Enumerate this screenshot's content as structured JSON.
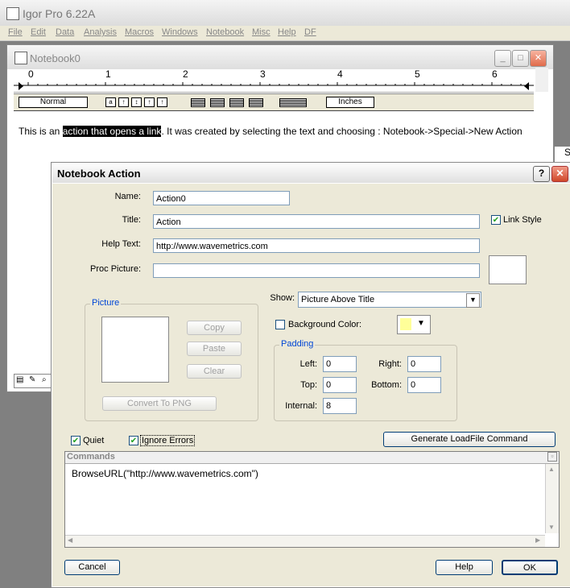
{
  "app": {
    "title": "Igor Pro 6.22A",
    "menu": [
      "File",
      "Edit",
      "Data",
      "Analysis",
      "Macros",
      "Windows",
      "Notebook",
      "Misc",
      "Help",
      "DF"
    ]
  },
  "notebook": {
    "title": "Notebook0",
    "ruler_numbers": [
      "0",
      "1",
      "2",
      "3",
      "4",
      "5",
      "6"
    ],
    "ruler_name": "Normal",
    "units": "Inches",
    "text_before": "This is an ",
    "text_highlight": "action that opens a link",
    "text_after": ". It was created by selecting the text and choosing : Notebook->Special->New Action",
    "side_peek": "S"
  },
  "dialog": {
    "title": "Notebook Action",
    "help_glyph": "?",
    "close_glyph": "✕",
    "name_label": "Name:",
    "name_value": "Action0",
    "title_label": "Title:",
    "title_value": "Action",
    "link_style_label": "Link Style",
    "help_text_label": "Help Text:",
    "help_text_value": "http://www.wavemetrics.com",
    "proc_picture_label": "Proc Picture:",
    "proc_picture_value": "",
    "picture_group": "Picture",
    "copy_label": "Copy",
    "paste_label": "Paste",
    "clear_label": "Clear",
    "convert_label": "Convert To PNG",
    "show_label": "Show:",
    "show_value": "Picture Above Title",
    "bg_color_label": "Background Color:",
    "padding_group": "Padding",
    "left_label": "Left:",
    "left_value": "0",
    "right_label": "Right:",
    "right_value": "0",
    "top_label": "Top:",
    "top_value": "0",
    "bottom_label": "Bottom:",
    "bottom_value": "0",
    "internal_label": "Internal:",
    "internal_value": "8",
    "quiet_label": "Quiet",
    "ignore_errors_label": "Ignore Errors",
    "generate_label": "Generate LoadFile Command",
    "commands_header": "Commands",
    "commands_text": "BrowseURL(\"http://www.wavemetrics.com\")",
    "cancel_label": "Cancel",
    "help_label": "Help",
    "ok_label": "OK"
  },
  "colors": {
    "bg_swatch": "#ffff99",
    "dialog_bg": "#ece9d8"
  }
}
